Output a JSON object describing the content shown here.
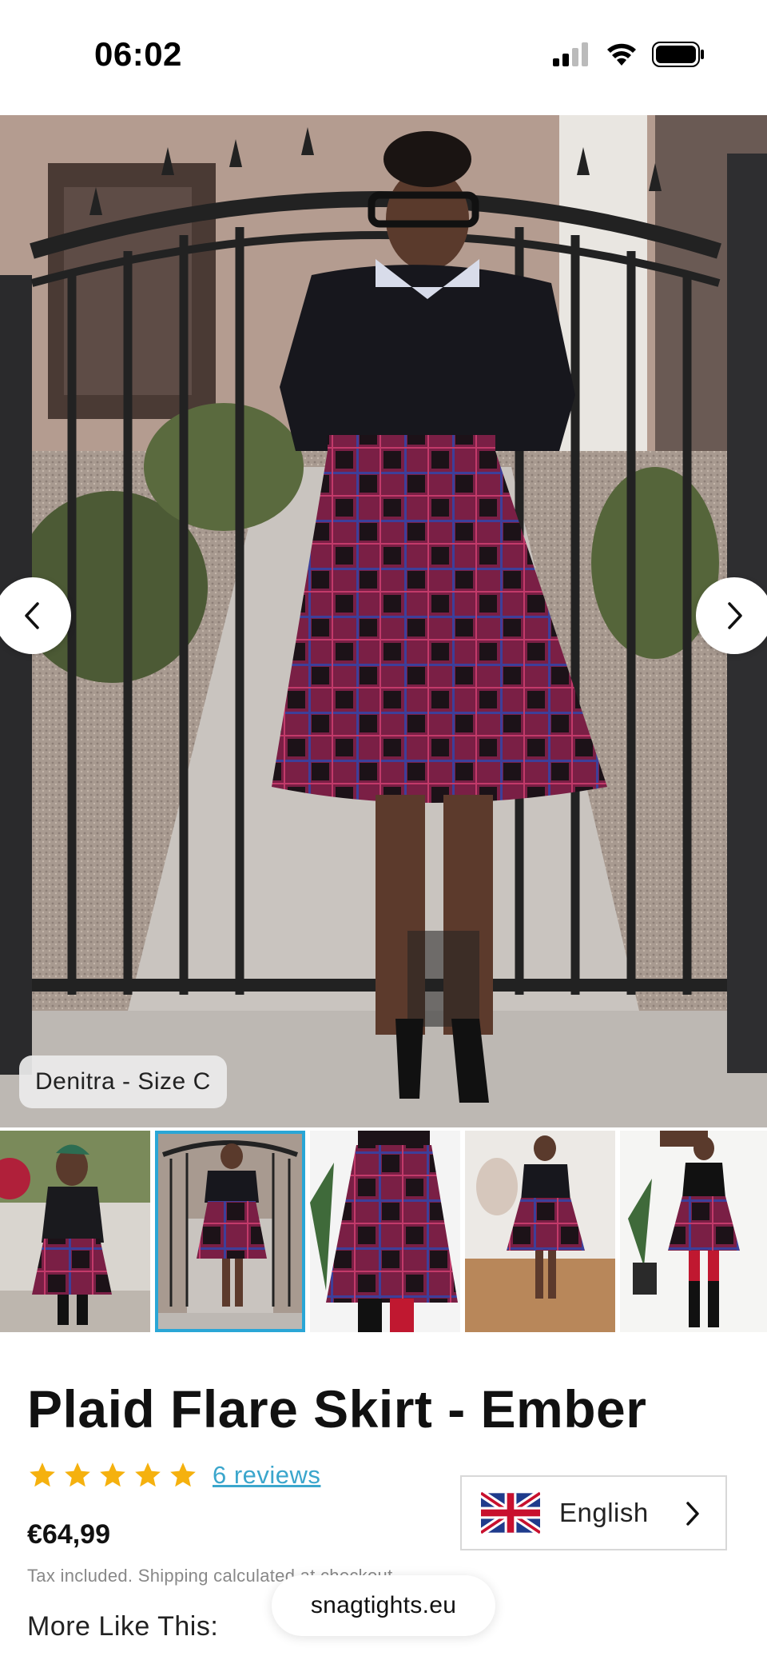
{
  "status_bar": {
    "time": "06:02",
    "icons": [
      "cellular-signal-icon",
      "wifi-icon",
      "battery-icon"
    ]
  },
  "gallery": {
    "prev_icon": "chevron-left-icon",
    "next_icon": "chevron-right-icon",
    "model_caption": "Denitra - Size C",
    "thumbnail_count": 5,
    "active_thumbnail": 2
  },
  "product": {
    "title": "Plaid Flare Skirt - Ember",
    "rating_stars": 5,
    "star_color": "#F5B10E",
    "reviews_label": "6 reviews",
    "price": "€64,99",
    "tax_note": "Tax included. Shipping calculated at checkout.",
    "more_like_this": "More Like This:"
  },
  "language_switcher": {
    "flag_icon": "uk-flag-icon",
    "label": "English",
    "chevron_icon": "chevron-right-icon"
  },
  "browser": {
    "url": "snagtights.eu"
  },
  "colors": {
    "accent": "#2AA6D6",
    "link": "#3BA6CC",
    "plaid_base": "#7A1F45",
    "plaid_line": "#3D3F9A"
  }
}
